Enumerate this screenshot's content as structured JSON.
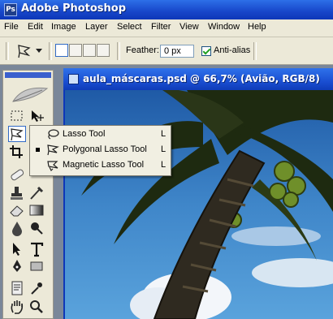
{
  "app": {
    "title": "Adobe Photoshop",
    "logo_text": "Ps"
  },
  "menu": [
    "File",
    "Edit",
    "Image",
    "Layer",
    "Select",
    "Filter",
    "View",
    "Window",
    "Help"
  ],
  "options": {
    "tool_icon": "polygonal-lasso-icon",
    "feather_label": "Feather:",
    "feather_value": "0 px",
    "antialias_label": "Anti-alias",
    "antialias_checked": true
  },
  "document": {
    "title": "aula_máscaras.psd @ 66,7% (Avião, RGB/8)"
  },
  "flyout": {
    "items": [
      {
        "name": "Lasso Tool",
        "key": "L",
        "selected": false,
        "icon": "lasso-icon"
      },
      {
        "name": "Polygonal Lasso Tool",
        "key": "L",
        "selected": true,
        "icon": "polygonal-lasso-icon"
      },
      {
        "name": "Magnetic Lasso Tool",
        "key": "L",
        "selected": false,
        "icon": "magnetic-lasso-icon"
      }
    ]
  },
  "colors": {
    "titlebar": "#1746c9",
    "chrome": "#ece9d8",
    "sky": "#3f86c9"
  }
}
